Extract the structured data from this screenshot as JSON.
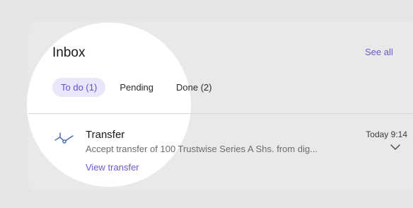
{
  "inbox": {
    "title": "Inbox",
    "see_all_label": "See all",
    "tabs": [
      {
        "label": "To do (1)",
        "active": true
      },
      {
        "label": "Pending",
        "active": false
      },
      {
        "label": "Done (2)",
        "active": false
      }
    ],
    "items": [
      {
        "icon": "transfer-icon",
        "title": "Transfer",
        "description": "Accept transfer of 100 Trustwise Series A Shs. from dig...",
        "link_label": "View transfer",
        "time": "Today 9:14"
      }
    ]
  },
  "colors": {
    "accent": "#6a5acd",
    "active_tab_bg": "#ebe7fb",
    "page_bg": "#e6e6e6"
  }
}
